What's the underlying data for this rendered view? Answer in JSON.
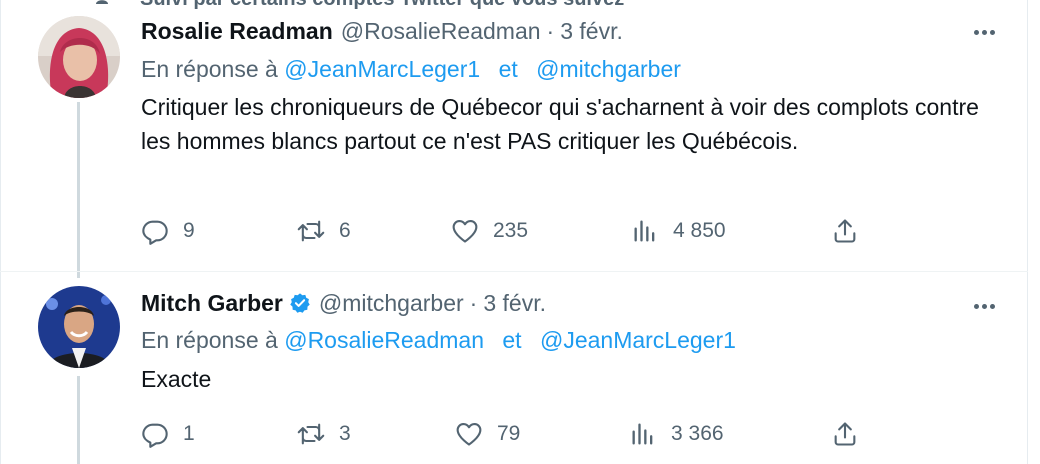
{
  "context": {
    "followed_text": "Suivi par certains comptes Twitter que vous suivez"
  },
  "tweets": [
    {
      "name": "Rosalie Readman",
      "handle": "@RosalieReadman",
      "separator": "·",
      "date": "3 févr.",
      "verified": false,
      "reply_prefix": "En réponse à",
      "reply_to": [
        "@JeanMarcLeger1",
        "@mitchgarber"
      ],
      "reply_join": "et",
      "text": "Critiquer les chroniqueurs de Québecor qui s'acharnent à voir des complots contre les hommes blancs partout ce n'est PAS critiquer les Québécois.",
      "replies": "9",
      "retweets": "6",
      "likes": "235",
      "views": "4 850"
    },
    {
      "name": "Mitch Garber",
      "handle": "@mitchgarber",
      "separator": "·",
      "date": "3 févr.",
      "verified": true,
      "reply_prefix": "En réponse à",
      "reply_to": [
        "@RosalieReadman",
        "@JeanMarcLeger1"
      ],
      "reply_join": "et",
      "text": "Exacte",
      "replies": "1",
      "retweets": "3",
      "likes": "79",
      "views": "3 366"
    }
  ],
  "icons": {
    "reply": "reply-icon",
    "retweet": "retweet-icon",
    "like": "heart-icon",
    "views": "views-icon",
    "share": "share-icon",
    "more": "more-icon",
    "verified": "verified-badge-icon"
  },
  "colors": {
    "text": "#0f1419",
    "secondary": "#536471",
    "link": "#1d9bf0",
    "thread_line": "#cfd9de"
  }
}
